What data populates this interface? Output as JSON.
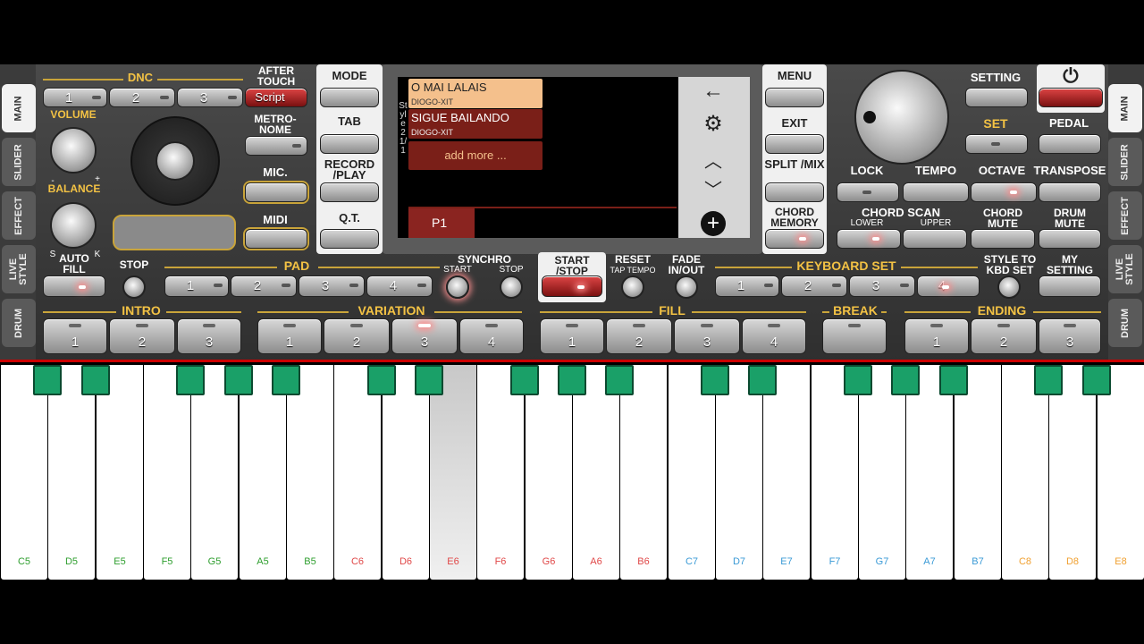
{
  "left_tabs": [
    "MAIN",
    "SLIDER",
    "EFFECT",
    "LIVE STYLE",
    "DRUM"
  ],
  "right_tabs": [
    "MAIN",
    "SLIDER",
    "EFFECT",
    "LIVE STYLE",
    "DRUM"
  ],
  "dnc": {
    "title": "DNC",
    "buttons": [
      "1",
      "2",
      "3"
    ],
    "script": "Script"
  },
  "after_touch": "AFTER TOUCH",
  "volume": "VOLUME",
  "balance": "BALANCE",
  "balance_marks": {
    "minus": "-",
    "plus": "+",
    "s": "S",
    "k": "K"
  },
  "metronome": "METRO- NOME",
  "mic": "MIC.",
  "midi": "MIDI",
  "mode": "MODE",
  "tab": "TAB",
  "record_play": "RECORD /PLAY",
  "qt": "Q.T.",
  "menu": "MENU",
  "exit": "EXIT",
  "split_mix": "SPLIT /MIX",
  "chord_memory": "CHORD MEMORY",
  "screen": {
    "style_label": "Style 2 1/1",
    "items": [
      {
        "title": "O MAI LALAIS",
        "sub": "DIOGO-XIT"
      },
      {
        "title": "SIGUE BAILANDO",
        "sub": "DIOGO-XIT"
      }
    ],
    "add_more": "add more ...",
    "page": "P1"
  },
  "setting": "SETTING",
  "set": "SET",
  "pedal": "PEDAL",
  "lock": "LOCK",
  "tempo": "TEMPO",
  "octave": "OCTAVE",
  "transpose": "TRANSPOSE",
  "chord_scan": "CHORD SCAN",
  "lower": "LOWER",
  "upper": "UPPER",
  "chord_mute": "CHORD MUTE",
  "drum_mute": "DRUM MUTE",
  "auto_fill": "AUTO FILL",
  "stop": "STOP",
  "pad": {
    "title": "PAD",
    "buttons": [
      "1",
      "2",
      "3",
      "4"
    ]
  },
  "synchro": "SYNCHRO",
  "sync_start": "START",
  "sync_stop": "STOP",
  "start_stop": "START /STOP",
  "reset": "RESET",
  "tap_tempo": "TAP TEMPO",
  "fade": "FADE IN/OUT",
  "keyboard_set": {
    "title": "KEYBOARD SET",
    "buttons": [
      "1",
      "2",
      "3",
      "4"
    ]
  },
  "style_to_kbd": "STYLE TO KBD SET",
  "my_setting": "MY SETTING",
  "intro": {
    "title": "INTRO",
    "buttons": [
      "1",
      "2",
      "3"
    ]
  },
  "variation": {
    "title": "VARIATION",
    "buttons": [
      "1",
      "2",
      "3",
      "4"
    ]
  },
  "fill": {
    "title": "FILL",
    "buttons": [
      "1",
      "2",
      "3",
      "4"
    ]
  },
  "break": "BREAK",
  "ending": {
    "title": "ENDING",
    "buttons": [
      "1",
      "2",
      "3"
    ]
  },
  "white_keys": [
    {
      "n": "C5",
      "c": "#2e9e2e"
    },
    {
      "n": "D5",
      "c": "#2e9e2e"
    },
    {
      "n": "E5",
      "c": "#2e9e2e"
    },
    {
      "n": "F5",
      "c": "#2e9e2e"
    },
    {
      "n": "G5",
      "c": "#2e9e2e"
    },
    {
      "n": "A5",
      "c": "#2e9e2e"
    },
    {
      "n": "B5",
      "c": "#2e9e2e"
    },
    {
      "n": "C6",
      "c": "#e04848"
    },
    {
      "n": "D6",
      "c": "#e04848"
    },
    {
      "n": "E6",
      "c": "#e04848"
    },
    {
      "n": "F6",
      "c": "#e04848"
    },
    {
      "n": "G6",
      "c": "#e04848"
    },
    {
      "n": "A6",
      "c": "#e04848"
    },
    {
      "n": "B6",
      "c": "#e04848"
    },
    {
      "n": "C7",
      "c": "#3a9ad6"
    },
    {
      "n": "D7",
      "c": "#3a9ad6"
    },
    {
      "n": "E7",
      "c": "#3a9ad6"
    },
    {
      "n": "F7",
      "c": "#3a9ad6"
    },
    {
      "n": "G7",
      "c": "#3a9ad6"
    },
    {
      "n": "A7",
      "c": "#3a9ad6"
    },
    {
      "n": "B7",
      "c": "#3a9ad6"
    },
    {
      "n": "C8",
      "c": "#f0a030"
    },
    {
      "n": "D8",
      "c": "#f0a030"
    },
    {
      "n": "E8",
      "c": "#f0a030"
    }
  ],
  "pressed_key": "E6"
}
